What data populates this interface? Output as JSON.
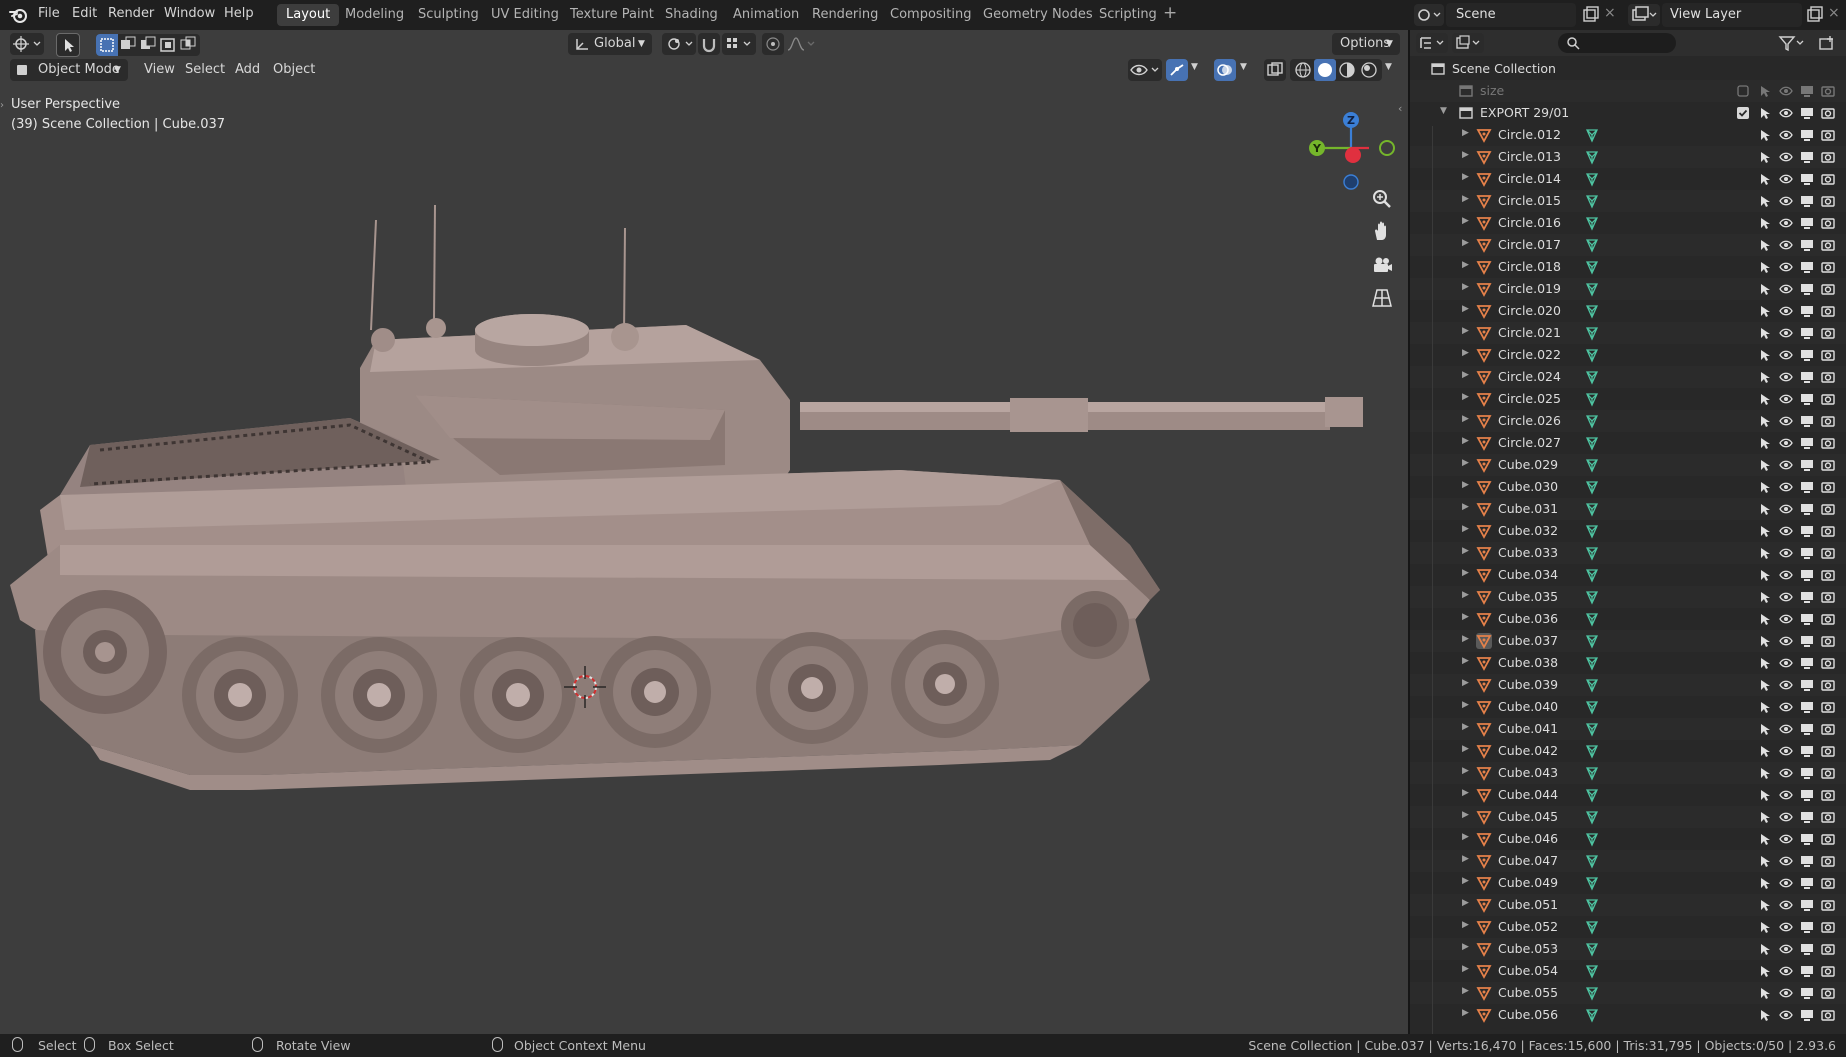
{
  "menu": [
    "File",
    "Edit",
    "Render",
    "Window",
    "Help"
  ],
  "workspaces": [
    {
      "label": "Layout",
      "active": true
    },
    {
      "label": "Modeling"
    },
    {
      "label": "Sculpting"
    },
    {
      "label": "UV Editing"
    },
    {
      "label": "Texture Paint"
    },
    {
      "label": "Shading"
    },
    {
      "label": "Animation"
    },
    {
      "label": "Rendering"
    },
    {
      "label": "Compositing"
    },
    {
      "label": "Geometry Nodes"
    },
    {
      "label": "Scripting"
    }
  ],
  "scene": {
    "name": "Scene",
    "view_layer": "View Layer"
  },
  "viewport": {
    "mode": "Object Mode",
    "menus": [
      "View",
      "Select",
      "Add",
      "Object"
    ],
    "transform_orientation": "Global",
    "options_label": "Options",
    "perspective": "User Perspective",
    "context": "(39) Scene Collection | Cube.037",
    "gizmo_axes": {
      "z": "Z",
      "y": "Y"
    }
  },
  "outliner": {
    "search_placeholder": "",
    "root": "Scene Collection",
    "size_item": "size",
    "collection": "EXPORT 29/01",
    "objects": [
      "Circle.012",
      "Circle.013",
      "Circle.014",
      "Circle.015",
      "Circle.016",
      "Circle.017",
      "Circle.018",
      "Circle.019",
      "Circle.020",
      "Circle.021",
      "Circle.022",
      "Circle.024",
      "Circle.025",
      "Circle.026",
      "Circle.027",
      "Cube.029",
      "Cube.030",
      "Cube.031",
      "Cube.032",
      "Cube.033",
      "Cube.034",
      "Cube.035",
      "Cube.036",
      "Cube.037",
      "Cube.038",
      "Cube.039",
      "Cube.040",
      "Cube.041",
      "Cube.042",
      "Cube.043",
      "Cube.044",
      "Cube.045",
      "Cube.046",
      "Cube.047",
      "Cube.049",
      "Cube.051",
      "Cube.052",
      "Cube.053",
      "Cube.054",
      "Cube.055",
      "Cube.056"
    ],
    "active_object": "Cube.037"
  },
  "statusbar": {
    "select": "Select",
    "box_select": "Box Select",
    "rotate_view": "Rotate View",
    "context_menu": "Object Context Menu",
    "stats": "Scene Collection | Cube.037 | Verts:16,470 | Faces:15,600 | Tris:31,795 | Objects:0/50 | 2.93.6"
  },
  "colors": {
    "accent": "#4772b3",
    "object_icon": "#e5814a",
    "mesh_icon": "#4ec3a1",
    "axis_x": "#e0303f",
    "axis_y": "#75b62b",
    "axis_z": "#3b7fd6"
  }
}
